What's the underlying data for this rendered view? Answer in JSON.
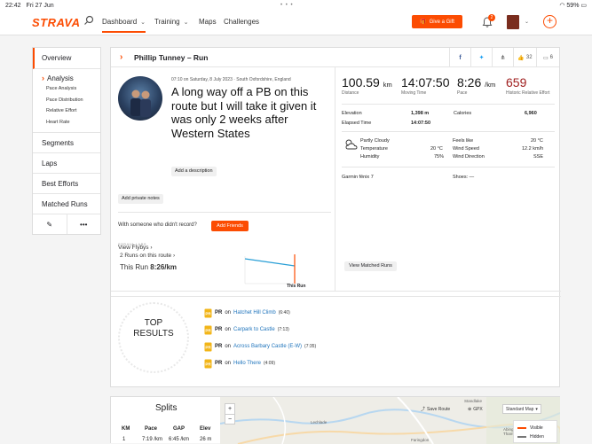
{
  "status_bar": {
    "time": "22:42",
    "date": "Fri 27 Jun",
    "battery": "59%"
  },
  "nav": {
    "logo": "STRAVA",
    "dashboard": "Dashboard",
    "training": "Training",
    "maps": "Maps",
    "challenges": "Challenges",
    "gift": "Give a Gift",
    "notifications_count": "2"
  },
  "sidebar": {
    "overview": "Overview",
    "analysis": "Analysis",
    "analysis_items": [
      "Pace Analysis",
      "Pace Distribution",
      "Relative Effort",
      "Heart Rate"
    ],
    "segments": "Segments",
    "laps": "Laps",
    "best_efforts": "Best Efforts",
    "matched_runs": "Matched Runs"
  },
  "header": {
    "title": "Phillip Tunney – Run",
    "kudos": "32",
    "comments": "6"
  },
  "activity": {
    "date": "07:10 on Saturday, 8 July 2023 · South Oxfordshire, England",
    "title": "A long way off a PB on this route but I will take it given it was only 2 weeks after Western States",
    "add_description": "Add a description",
    "add_private_notes": "Add private notes",
    "with_someone": "With someone who didn't record?",
    "add_friends": "Add Friends",
    "labs": "STRAVA LABS",
    "view_flybys": "View Flybys"
  },
  "stats": {
    "distance_value": "100.59",
    "distance_unit": "km",
    "distance_label": "Distance",
    "moving_time_value": "14:07:50",
    "moving_time_label": "Moving Time",
    "pace_value": "8:26",
    "pace_unit": "/km",
    "pace_label": "Pace",
    "effort_value": "659",
    "effort_label": "Historic Relative Effort",
    "elevation_label": "Elevation",
    "elevation_value": "1,398 m",
    "calories_label": "Calories",
    "calories_value": "6,960",
    "elapsed_label": "Elapsed Time",
    "elapsed_value": "14:07:50"
  },
  "weather": {
    "condition": "Partly Cloudy",
    "temp_label": "Temperature",
    "temp_value": "20 °C",
    "humidity_label": "Humidity",
    "humidity_value": "75%",
    "feels_label": "Feels like",
    "feels_value": "20 °C",
    "wind_speed_label": "Wind Speed",
    "wind_speed_value": "12.2 km/h",
    "wind_dir_label": "Wind Direction",
    "wind_dir_value": "SSE"
  },
  "gear": {
    "device": "Garmin fēnix 7",
    "shoes": "Shoes: —"
  },
  "route": {
    "runs_on_route": "2 Runs on this route",
    "this_run_label": "This Run",
    "this_run_pace": "8:26/km",
    "this_run_marker": "This Run",
    "view_matched": "View Matched Runs"
  },
  "top_results": {
    "title_line1": "TOP",
    "title_line2": "RESULTS",
    "items": [
      {
        "pr": "PR",
        "on": "on",
        "segment": "Hatchet Hill Climb",
        "time": "(6:40)"
      },
      {
        "pr": "PR",
        "on": "on",
        "segment": "Carpark to Castle",
        "time": "(7:13)"
      },
      {
        "pr": "PR",
        "on": "on",
        "segment": "Across Barbary Castle (E-W)",
        "time": "(7:35)"
      },
      {
        "pr": "PR",
        "on": "on",
        "segment": "Hello There",
        "time": "(4:09)"
      }
    ]
  },
  "splits": {
    "title": "Splits",
    "headers": [
      "KM",
      "Pace",
      "GAP",
      "Elev"
    ],
    "row1": [
      "1",
      "7:19 /km",
      "6:45 /km",
      "26 m"
    ]
  },
  "map": {
    "save_route": "Save Route",
    "gpx": "GPX",
    "style": "Standard Map",
    "visible": "Visible",
    "hidden": "Hidden",
    "place_lechlade": "Lechlade",
    "place_standlake": "Standlake",
    "place_abingdon": "Abingdon-on-Thames",
    "place_faringdon": "Faringdon"
  },
  "colors": {
    "accent": "#fc4c02",
    "link": "#1f74bc",
    "effort": "#a02020"
  }
}
